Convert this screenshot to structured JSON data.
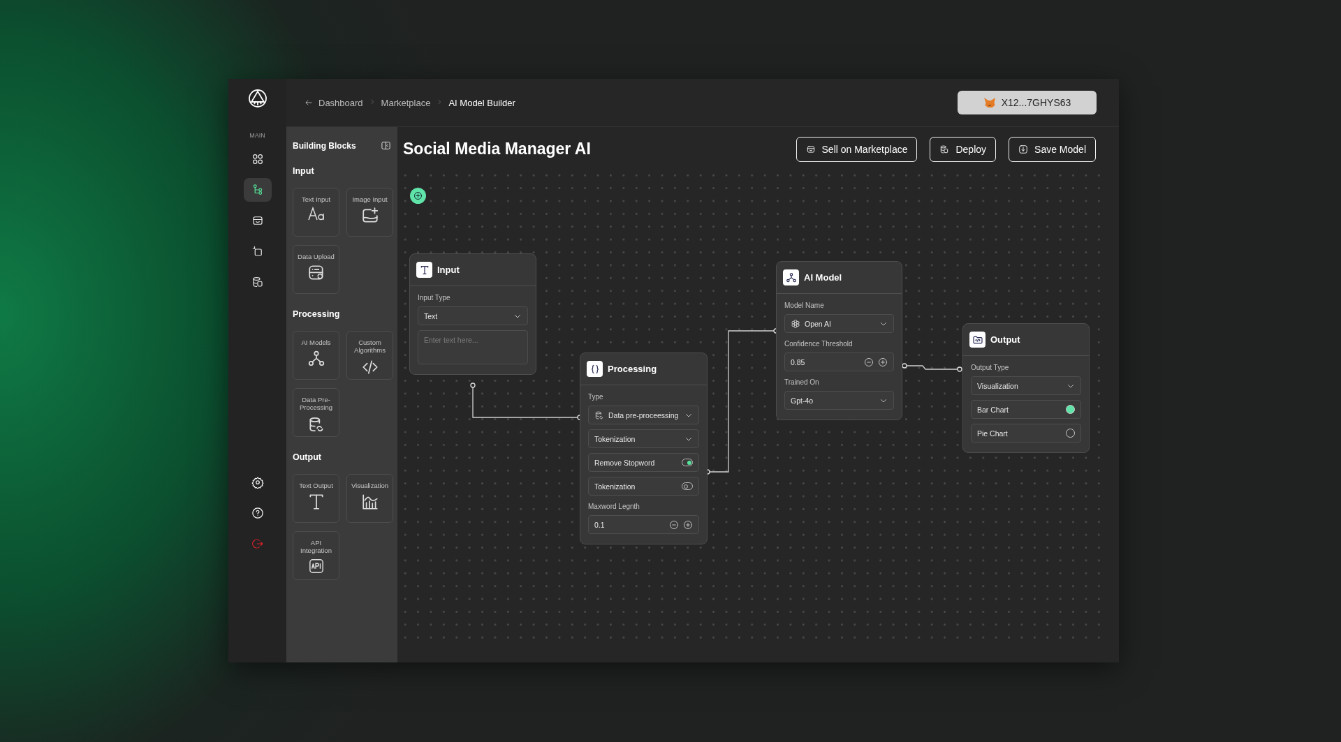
{
  "sidebar": {
    "section_label": "MAIN",
    "nav": [
      {
        "selected": false
      },
      {
        "selected": true
      },
      {
        "selected": false
      },
      {
        "selected": false
      },
      {
        "selected": false
      }
    ],
    "bottom": [
      {
        "kind": "settings"
      },
      {
        "kind": "help"
      },
      {
        "kind": "logout"
      }
    ]
  },
  "breadcrumb": [
    {
      "label": "Dashboard",
      "kind": "back",
      "current": false
    },
    {
      "label": "Marketplace",
      "kind": "link",
      "current": false
    },
    {
      "label": "AI Model Builder",
      "kind": "link",
      "current": true
    }
  ],
  "wallet": {
    "address": "X12...7GHYS63"
  },
  "blocks_panel": {
    "title": "Building Blocks",
    "groups": [
      {
        "title": "Input",
        "blocks": [
          {
            "label": "Text Input",
            "kind": "text"
          },
          {
            "label": "Image Input",
            "kind": "image"
          },
          {
            "label": "Data Upload",
            "kind": "upload"
          }
        ]
      },
      {
        "title": "Processing",
        "blocks": [
          {
            "label": "AI Models",
            "kind": "model"
          },
          {
            "label": "Custom Algorithms",
            "kind": "code"
          },
          {
            "label": "Data Pre-Processing",
            "kind": "database"
          }
        ]
      },
      {
        "title": "Output",
        "blocks": [
          {
            "label": "Text Output",
            "kind": "text-output"
          },
          {
            "label": "Visualization",
            "kind": "chart"
          },
          {
            "label": "API Integration",
            "kind": "api"
          }
        ]
      }
    ]
  },
  "title": "Social Media Manager AI",
  "actions": [
    {
      "label": "Sell on Marketplace",
      "kind": "store"
    },
    {
      "label": "Deploy",
      "kind": "deploy"
    },
    {
      "label": "Save Model",
      "kind": "save"
    }
  ],
  "nodes": [
    {
      "title": "Input",
      "kind": "input",
      "fields": [
        {
          "kind": "label",
          "text": "Input Type"
        },
        {
          "kind": "select",
          "value": "Text"
        },
        {
          "kind": "textarea",
          "placeholder": "Enter text here..."
        }
      ]
    },
    {
      "title": "Processing",
      "kind": "processing",
      "fields": [
        {
          "kind": "label",
          "text": "Type"
        },
        {
          "kind": "icon-select",
          "value": "Data pre-proceessing"
        },
        {
          "kind": "select",
          "value": "Tokenization"
        },
        {
          "kind": "toggle",
          "text": "Remove Stopword",
          "on": true
        },
        {
          "kind": "toggle",
          "text": "Tokenization",
          "on": false
        },
        {
          "kind": "label",
          "text": "Maxword Legnth"
        },
        {
          "kind": "stepper",
          "value": "0.1"
        }
      ]
    },
    {
      "title": "AI Model",
      "kind": "model",
      "fields": [
        {
          "kind": "label",
          "text": "Model Name"
        },
        {
          "kind": "icon-select",
          "value": "Open AI"
        },
        {
          "kind": "label",
          "text": "Confidence Threshold"
        },
        {
          "kind": "stepper",
          "value": "0.85"
        },
        {
          "kind": "label",
          "text": "Trained On"
        },
        {
          "kind": "select",
          "value": "Gpt-4o"
        }
      ]
    },
    {
      "title": "Output",
      "kind": "output",
      "fields": [
        {
          "kind": "label",
          "text": "Output Type"
        },
        {
          "kind": "select",
          "value": "Visualization"
        },
        {
          "kind": "radio",
          "text": "Bar Chart",
          "selected": true
        },
        {
          "kind": "radio",
          "text": "Pie Chart",
          "selected": false
        }
      ]
    }
  ]
}
